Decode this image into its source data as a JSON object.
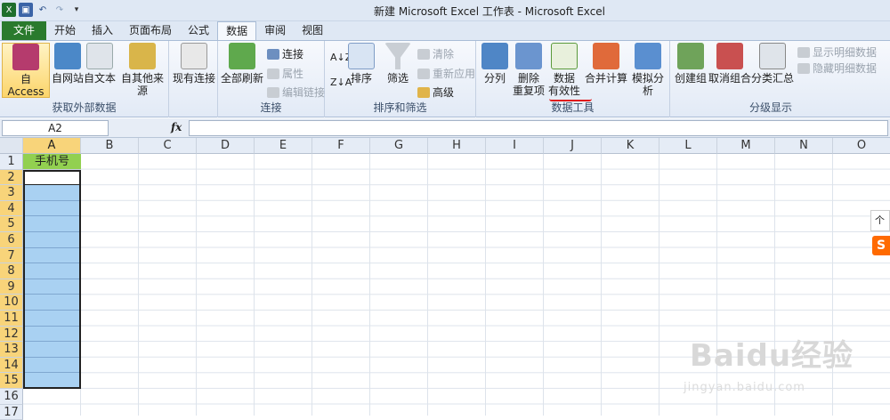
{
  "window": {
    "title": "新建 Microsoft Excel 工作表 - Microsoft Excel"
  },
  "qat": {
    "items": [
      "excel-logo",
      "save",
      "undo",
      "redo",
      "customize"
    ]
  },
  "tabs": [
    "文件",
    "开始",
    "插入",
    "页面布局",
    "公式",
    "数据",
    "审阅",
    "视图"
  ],
  "active_tab": "数据",
  "ribbon": {
    "groups": [
      {
        "label": "获取外部数据",
        "buttons": [
          "自 Access",
          "自网站",
          "自文本",
          "自其他来源"
        ]
      },
      {
        "label": "",
        "buttons": [
          "现有连接"
        ]
      },
      {
        "label": "连接",
        "buttons": [
          "全部刷新"
        ],
        "small": [
          "连接",
          "属性",
          "编辑链接"
        ]
      },
      {
        "label": "排序和筛选",
        "buttons": [
          "排序",
          "筛选"
        ],
        "small": [
          "清除",
          "重新应用",
          "高级"
        ]
      },
      {
        "label": "数据工具",
        "buttons": [
          "分列",
          "删除",
          "重复项",
          "数据",
          "有效性",
          "合并计算",
          "模拟分析"
        ]
      },
      {
        "label": "分级显示",
        "buttons": [
          "创建组",
          "取消组合",
          "分类汇总"
        ],
        "small": [
          "显示明细数据",
          "隐藏明细数据"
        ]
      }
    ]
  },
  "formula_bar": {
    "name_box": "A2",
    "fx": "fx",
    "value": ""
  },
  "columns": [
    "A",
    "B",
    "C",
    "D",
    "E",
    "F",
    "G",
    "H",
    "I",
    "J",
    "K",
    "L",
    "M",
    "N",
    "O"
  ],
  "rows": [
    "1",
    "2",
    "3",
    "4",
    "5",
    "6",
    "7",
    "8",
    "9",
    "10",
    "11",
    "12",
    "13",
    "14",
    "15",
    "16",
    "17"
  ],
  "cells": {
    "A1": "手机号"
  },
  "watermark": {
    "brand": "Baidu经验",
    "url": "jingyan.baidu.com"
  },
  "side": {
    "chip": "个性",
    "logo": "S"
  },
  "colors": {
    "file_tab": "#2a7a2d",
    "header_fill": "#92d050",
    "selection_fill": "#a9d1f2",
    "highlight": "#fcd56b"
  }
}
